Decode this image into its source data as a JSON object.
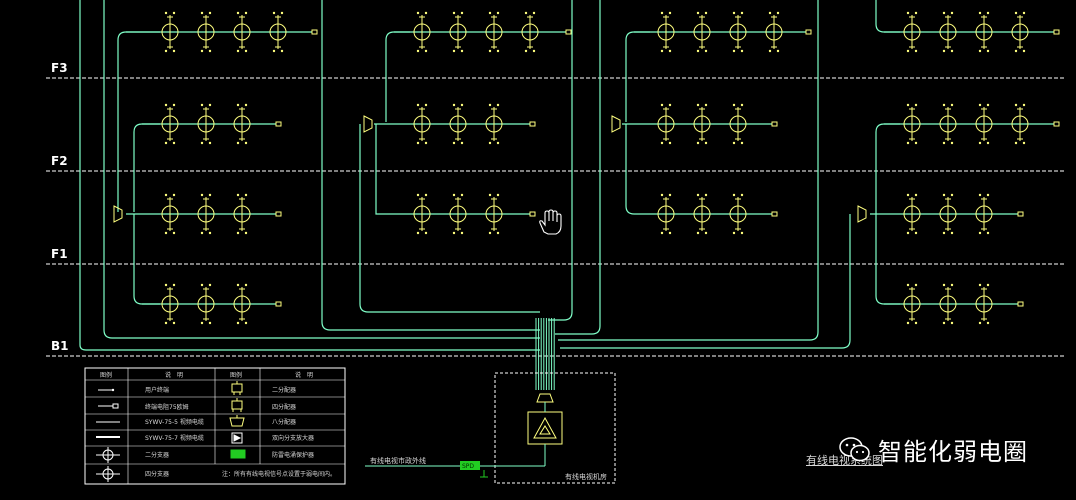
{
  "floors": [
    "F3",
    "F2",
    "F1",
    "B1"
  ],
  "legend": {
    "headers": [
      "图例",
      "说　明",
      "图例",
      "说　明"
    ],
    "left_items": [
      "用户终端",
      "终端电阻75欧姆",
      "SYWV-75-5 视频电缆",
      "SYWV-75-7 视频电缆",
      "二分支器",
      "四分支器"
    ],
    "right_items": [
      "二分配器",
      "四分配器",
      "八分配器",
      "双向分支放大器",
      "防雷电涌保护器"
    ],
    "note": "注：所有有线电视信号点设置于弱电间内。"
  },
  "labels": {
    "incoming": "有线电视市政外线",
    "room": "有线电视机房",
    "surge_box": "SPD",
    "caption": "有线电视系统图",
    "watermark": "智能化弱电圈"
  },
  "colors": {
    "trunk": "#7fffc8",
    "device": "#ffff7f",
    "line": "#ffffff",
    "spd": "#22cc22"
  }
}
